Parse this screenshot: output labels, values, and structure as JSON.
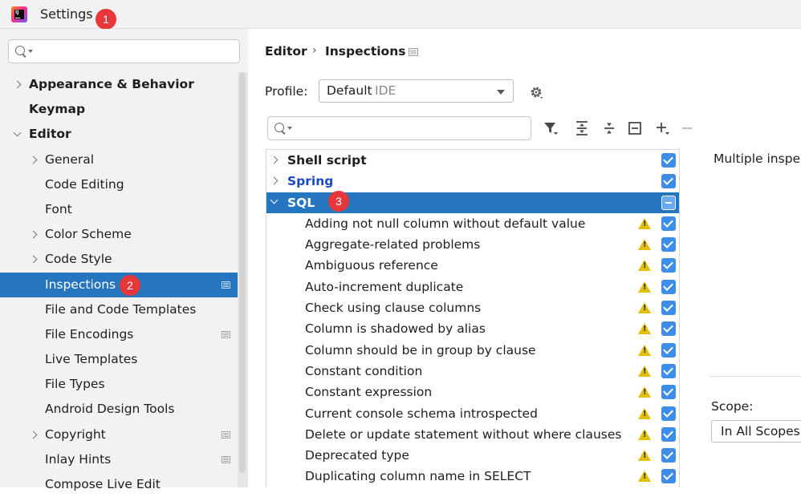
{
  "window": {
    "title": "Settings"
  },
  "badges": [
    "1",
    "2",
    "3"
  ],
  "sidebar": {
    "search_placeholder": "",
    "items": [
      {
        "label": "Appearance & Behavior",
        "level": 0,
        "bold": true,
        "chevron": "right",
        "page_icon": false
      },
      {
        "label": "Keymap",
        "level": 0,
        "bold": true,
        "chevron": "none",
        "page_icon": false
      },
      {
        "label": "Editor",
        "level": 0,
        "bold": true,
        "chevron": "down",
        "page_icon": false
      },
      {
        "label": "General",
        "level": 1,
        "bold": false,
        "chevron": "right",
        "page_icon": false
      },
      {
        "label": "Code Editing",
        "level": 1,
        "bold": false,
        "chevron": "none",
        "page_icon": false
      },
      {
        "label": "Font",
        "level": 1,
        "bold": false,
        "chevron": "none",
        "page_icon": false
      },
      {
        "label": "Color Scheme",
        "level": 1,
        "bold": false,
        "chevron": "right",
        "page_icon": false
      },
      {
        "label": "Code Style",
        "level": 1,
        "bold": false,
        "chevron": "right",
        "page_icon": false
      },
      {
        "label": "Inspections",
        "level": 1,
        "bold": false,
        "chevron": "none",
        "page_icon": true,
        "selected": true
      },
      {
        "label": "File and Code Templates",
        "level": 1,
        "bold": false,
        "chevron": "none",
        "page_icon": false
      },
      {
        "label": "File Encodings",
        "level": 1,
        "bold": false,
        "chevron": "none",
        "page_icon": true
      },
      {
        "label": "Live Templates",
        "level": 1,
        "bold": false,
        "chevron": "none",
        "page_icon": false
      },
      {
        "label": "File Types",
        "level": 1,
        "bold": false,
        "chevron": "none",
        "page_icon": false
      },
      {
        "label": "Android Design Tools",
        "level": 1,
        "bold": false,
        "chevron": "none",
        "page_icon": false
      },
      {
        "label": "Copyright",
        "level": 1,
        "bold": false,
        "chevron": "right",
        "page_icon": true
      },
      {
        "label": "Inlay Hints",
        "level": 1,
        "bold": false,
        "chevron": "none",
        "page_icon": true
      },
      {
        "label": "Compose Live Edit",
        "level": 1,
        "bold": false,
        "chevron": "none",
        "page_icon": false
      }
    ]
  },
  "breadcrumb": {
    "parent": "Editor",
    "separator": "›",
    "current": "Inspections"
  },
  "profile": {
    "label": "Profile:",
    "value": "Default",
    "tag": "IDE"
  },
  "inspection_search_placeholder": "",
  "inspections": [
    {
      "label": "Shell script",
      "type": "group",
      "chevron": "right",
      "check": "checked"
    },
    {
      "label": "Spring",
      "type": "group",
      "chevron": "right",
      "check": "checked",
      "color": "#1a48c8"
    },
    {
      "label": "SQL",
      "type": "group",
      "chevron": "down",
      "check": "partial",
      "selected": true
    },
    {
      "label": "Adding not null column without default value",
      "type": "item",
      "check": "checked",
      "warning": true
    },
    {
      "label": "Aggregate-related problems",
      "type": "item",
      "check": "checked",
      "warning": true
    },
    {
      "label": "Ambiguous reference",
      "type": "item",
      "check": "checked",
      "warning": true
    },
    {
      "label": "Auto-increment duplicate",
      "type": "item",
      "check": "checked",
      "warning": true
    },
    {
      "label": "Check using clause columns",
      "type": "item",
      "check": "checked",
      "warning": true
    },
    {
      "label": "Column is shadowed by alias",
      "type": "item",
      "check": "checked",
      "warning": true
    },
    {
      "label": "Column should be in group by clause",
      "type": "item",
      "check": "checked",
      "warning": true
    },
    {
      "label": "Constant condition",
      "type": "item",
      "check": "checked",
      "warning": true
    },
    {
      "label": "Constant expression",
      "type": "item",
      "check": "checked",
      "warning": true
    },
    {
      "label": "Current console schema introspected",
      "type": "item",
      "check": "checked",
      "warning": true
    },
    {
      "label": "Delete or update statement without where clauses",
      "type": "item",
      "check": "checked",
      "warning": true
    },
    {
      "label": "Deprecated type",
      "type": "item",
      "check": "checked",
      "warning": true
    },
    {
      "label": "Duplicating column name in SELECT",
      "type": "item",
      "check": "checked",
      "warning": true
    }
  ],
  "details": {
    "text": "Multiple inspec"
  },
  "scope": {
    "label": "Scope:",
    "value": "In All Scopes"
  },
  "icons": {
    "app": "intellij-idea-icon",
    "search": "search-icon",
    "gear": "gear-icon",
    "filter": "filter-icon",
    "expand_all": "expand-all-icon",
    "collapse_all": "collapse-all-icon",
    "reset": "reset-icon",
    "add": "add-icon",
    "remove": "remove-icon"
  },
  "colors": {
    "selection": "#2675bf",
    "checkbox": "#3d8ee8",
    "warning": "#e2c00a",
    "badge": "#e8373a"
  }
}
